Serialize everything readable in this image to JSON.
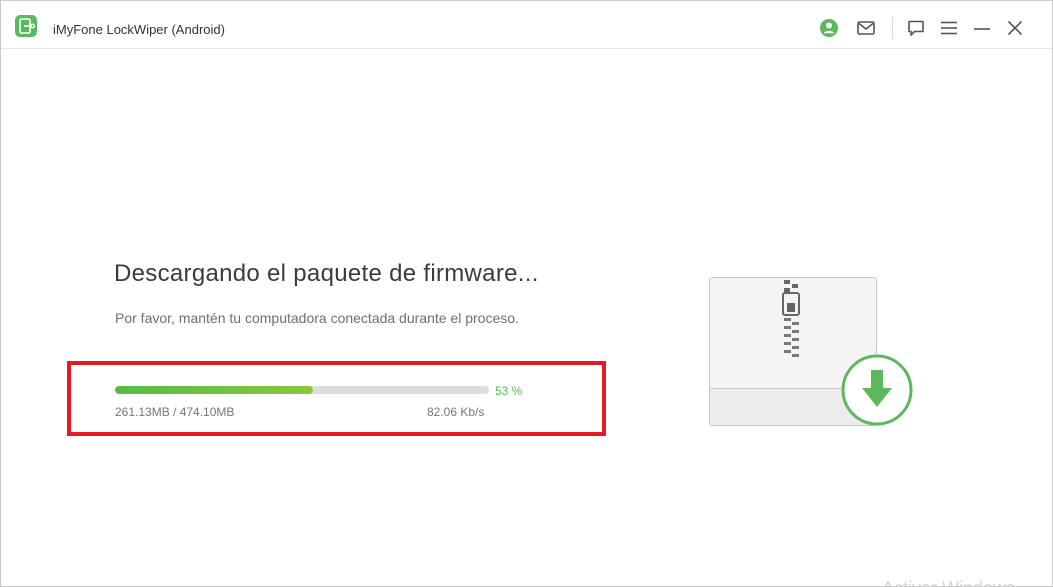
{
  "window": {
    "title": "iMyFone LockWiper (Android)"
  },
  "titlebar": {
    "icons": [
      "account-icon",
      "mail-icon",
      "feedback-icon",
      "menu-icon",
      "minimize-icon",
      "close-icon"
    ],
    "accent_color": "#5cb85c"
  },
  "main": {
    "title": "Descargando el paquete de firmware...",
    "subtitle": "Por favor, mantén tu computadora conectada durante el proceso."
  },
  "progress": {
    "percent": 53,
    "percent_label": "53 %",
    "downloaded_label": "261.13MB / 474.10MB",
    "speed_label": "82.06 Kb/s",
    "fill_color": "#6abf40",
    "track_color": "#dddddd"
  },
  "highlight": {
    "color": "#e31c23"
  },
  "illustration": {
    "icons": [
      "zip-archive-icon",
      "download-arrow-icon"
    ]
  },
  "watermark": {
    "text": "Activar Windows"
  }
}
